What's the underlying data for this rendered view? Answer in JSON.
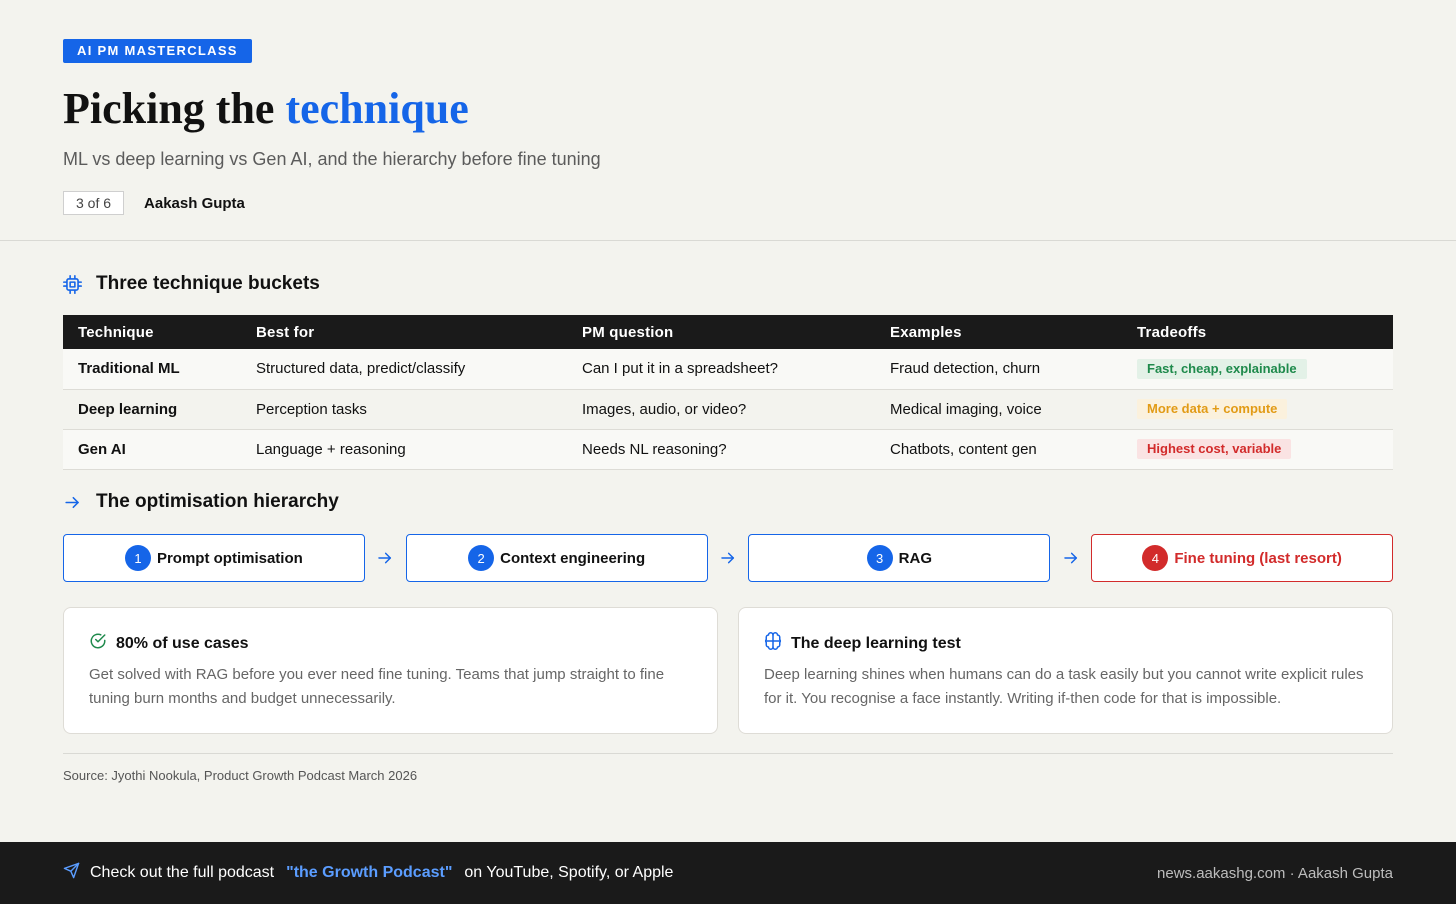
{
  "header": {
    "badge": "AI PM MASTERCLASS",
    "title_prefix": "Picking the",
    "title_accent": "technique",
    "subtitle": "ML vs deep learning vs Gen AI, and the hierarchy before fine tuning",
    "page_count": "3 of 6",
    "author": "Aakash Gupta"
  },
  "buckets": {
    "heading": "Three technique buckets",
    "icon": "cpu-chip-icon",
    "columns": [
      "Technique",
      "Best for",
      "PM question",
      "Examples",
      "Tradeoffs"
    ],
    "rows": [
      {
        "technique": "Traditional ML",
        "best_for": "Structured data, predict/classify",
        "question": "Can I put it in a spreadsheet?",
        "examples": "Fraud detection, churn",
        "tradeoff": "Fast, cheap, explainable",
        "tone": "green"
      },
      {
        "technique": "Deep learning",
        "best_for": "Perception tasks",
        "question": "Images, audio, or video?",
        "examples": "Medical imaging, voice",
        "tradeoff": "More data + compute",
        "tone": "amber"
      },
      {
        "technique": "Gen AI",
        "best_for": "Language + reasoning",
        "question": "Needs NL reasoning?",
        "examples": "Chatbots, content gen",
        "tradeoff": "Highest cost, variable",
        "tone": "red"
      }
    ]
  },
  "hierarchy": {
    "heading": "The optimisation hierarchy",
    "icon": "arrow-right-icon",
    "steps": [
      {
        "num": "1",
        "label": "Prompt optimisation"
      },
      {
        "num": "2",
        "label": "Context engineering"
      },
      {
        "num": "3",
        "label": "RAG"
      },
      {
        "num": "4",
        "label": "Fine tuning (last resort)"
      }
    ]
  },
  "cards": [
    {
      "icon": "check-circle-icon",
      "title": "80% of use cases",
      "body": "Get solved with RAG before you ever need fine tuning. Teams that jump straight to fine tuning burn months and budget unnecessarily."
    },
    {
      "icon": "brain-icon",
      "title": "The deep learning test",
      "body": "Deep learning shines when humans can do a task easily but you cannot write explicit rules for it. You recognise a face instantly. Writing if-then code for that is impossible."
    }
  ],
  "source": "Source: Jyothi Nookula, Product Growth Podcast March 2026",
  "footer": {
    "icon": "send-icon",
    "lead": "Check out the full podcast",
    "podcast": "\"the Growth Podcast\"",
    "tail": "on YouTube, Spotify, or Apple",
    "right": "news.aakashg.com · Aakash Gupta"
  },
  "colors": {
    "accent": "#1565e8",
    "danger": "#d22b2b",
    "background": "#f3f3ee",
    "footer": "#1a1a1a"
  }
}
